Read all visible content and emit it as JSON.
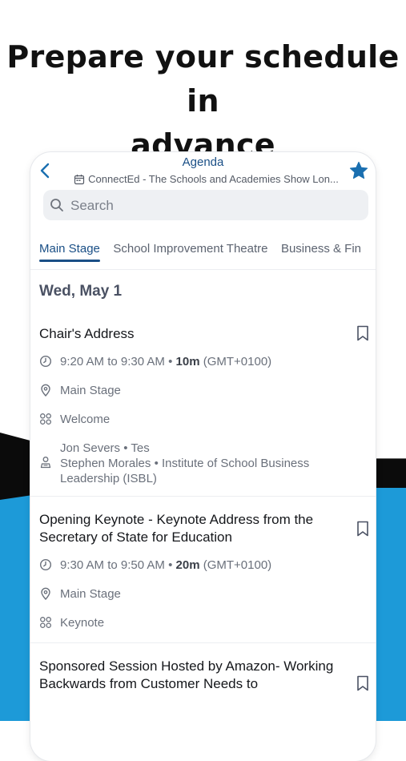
{
  "promo": {
    "title_line1": "Prepare your schedule in",
    "title_line2": "advance"
  },
  "header": {
    "title": "Agenda",
    "event_name": "ConnectEd - The Schools and Academies Show Lon..."
  },
  "search": {
    "placeholder": "Search"
  },
  "tabs": [
    {
      "label": "Main Stage",
      "active": true
    },
    {
      "label": "School Improvement Theatre",
      "active": false
    },
    {
      "label": "Business & Fin",
      "active": false
    }
  ],
  "day_heading": "Wed, May 1",
  "sessions": [
    {
      "title": "Chair's Address",
      "time": "9:20 AM to 9:30 AM",
      "duration": "10m",
      "timezone": "(GMT+0100)",
      "location": "Main Stage",
      "track": "Welcome",
      "speakers": [
        "Jon Severs • Tes",
        "Stephen Morales • Institute of School Business",
        "Leadership (ISBL)"
      ]
    },
    {
      "title": "Opening Keynote - Keynote Address from the Secretary of State for Education",
      "time": "9:30 AM to 9:50 AM",
      "duration": "20m",
      "timezone": "(GMT+0100)",
      "location": "Main Stage",
      "track": "Keynote"
    },
    {
      "title": "Sponsored Session Hosted by Amazon- Working Backwards from Customer Needs to"
    }
  ],
  "colors": {
    "accent": "#1a4f86",
    "blue_shape": "#1d9ad8",
    "black_shape": "#0b0b0b"
  }
}
